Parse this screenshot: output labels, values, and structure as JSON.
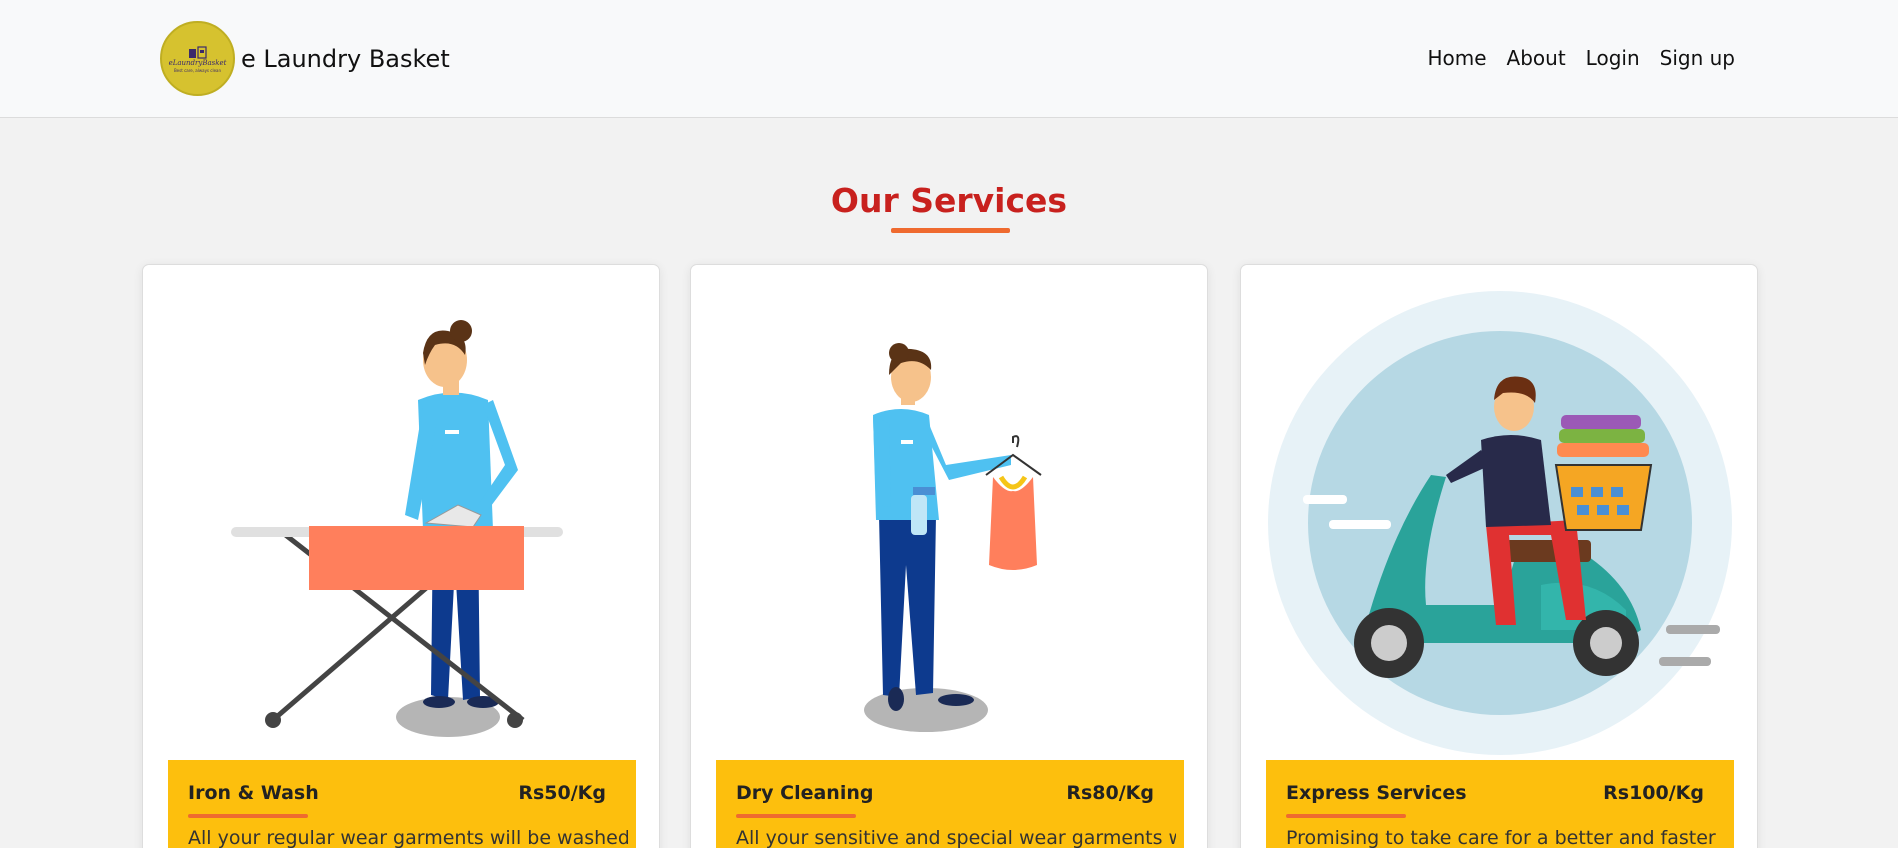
{
  "brand": {
    "logo_text": "eLaundryBasket",
    "logo_tagline": "Best care, always clean",
    "name": "e Laundry Basket"
  },
  "nav": {
    "items": [
      "Home",
      "About",
      "Login",
      "Sign up"
    ]
  },
  "services": {
    "title": "Our Services",
    "cards": [
      {
        "name": "Iron & Wash",
        "price": "Rs50/Kg",
        "description": "All your regular wear garments will be washed,"
      },
      {
        "name": "Dry Cleaning",
        "price": "Rs80/Kg",
        "description": "All your sensitive and special wear garments will"
      },
      {
        "name": "Express Services",
        "price": "Rs100/Kg",
        "description": "Promising to take care for a better and faster"
      }
    ]
  },
  "colors": {
    "title_red": "#c8211e",
    "accent_orange": "#ef6a2f",
    "card_yellow": "#fdbf0d",
    "logo_yellow": "#d6c22f"
  }
}
